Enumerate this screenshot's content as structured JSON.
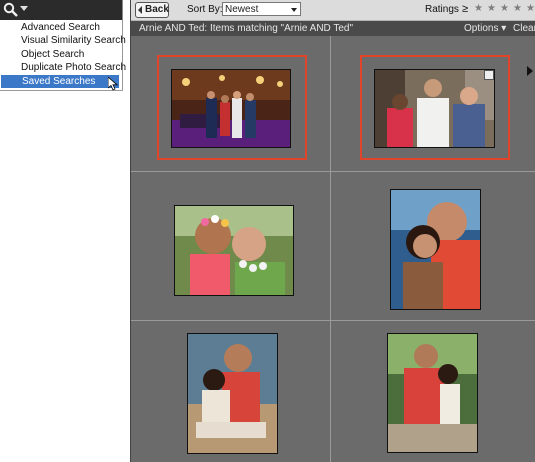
{
  "search_menu": {
    "icon": "magnifier-icon",
    "items": [
      {
        "label": "Advanced Search"
      },
      {
        "label": "Visual Similarity Search"
      },
      {
        "label": "Object Search"
      },
      {
        "label": "Duplicate Photo Search"
      },
      {
        "label": "Saved Searches",
        "selected": true
      }
    ]
  },
  "toolbar": {
    "back_label": "Back",
    "sort_label": "Sort By:",
    "sort_value": "Newest",
    "ratings_label": "Ratings",
    "ratings_operator": "≥",
    "rating_stars": 5,
    "rating_value": 0
  },
  "titlebar": {
    "query_title": "Arnie AND Ted: Items matching \"Arnie AND Ted\"",
    "options_label": "Options ▾",
    "clear_label": "Clear"
  },
  "photos": [
    {
      "name": "group-photo-bar",
      "highlighted": true
    },
    {
      "name": "three-people-chef",
      "highlighted": true,
      "edited": true
    },
    {
      "name": "couple-lei-laughing",
      "highlighted": false
    },
    {
      "name": "couple-portrait",
      "highlighted": false
    },
    {
      "name": "couple-beach-sitting",
      "highlighted": false
    },
    {
      "name": "couple-beach-standing",
      "highlighted": false
    }
  ],
  "colors": {
    "highlight": "#e0452c",
    "selection": "#3b78c8",
    "grid_bg": "#6b6b6b"
  }
}
